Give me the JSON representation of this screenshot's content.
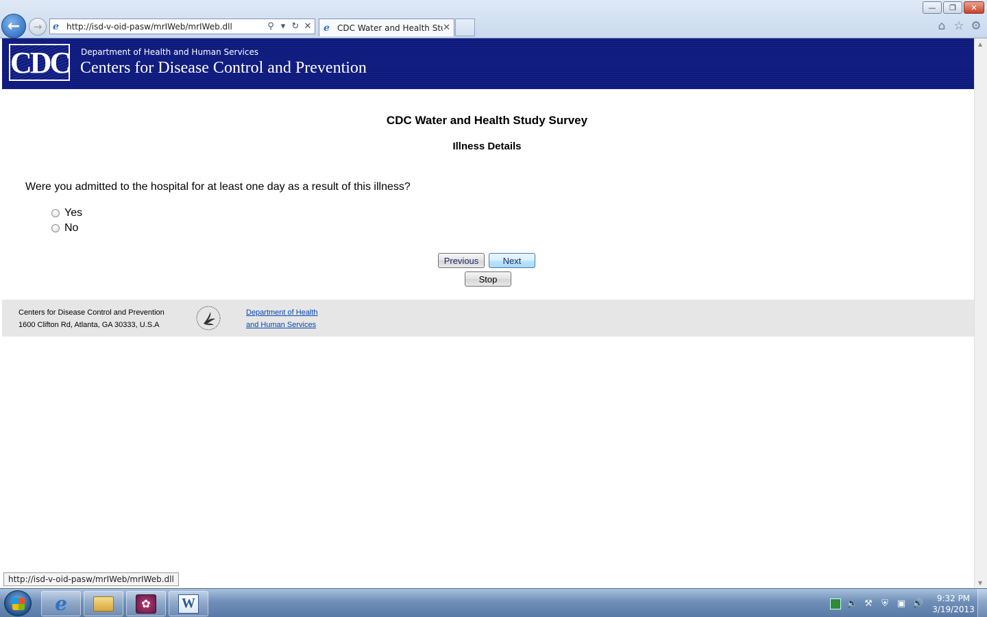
{
  "browser": {
    "address_url": "http://isd-v-oid-pasw/mrIWeb/mrIWeb.dll",
    "tab_title": "CDC Water and Health Study",
    "window_buttons": [
      "minimize",
      "restore",
      "close"
    ],
    "toolbar_icons": [
      "home-icon",
      "star-icon",
      "gear-icon"
    ]
  },
  "header": {
    "logo_text": "CDC",
    "department": "Department of Health and Human Services",
    "agency": "Centers for Disease Control and Prevention"
  },
  "survey": {
    "title": "CDC Water and Health Study Survey",
    "section": "Illness Details",
    "question": "Were you admitted to the hospital for at least one day as a result of this illness?",
    "options": [
      {
        "label": "Yes",
        "selected": false
      },
      {
        "label": "No",
        "selected": false
      }
    ],
    "buttons": {
      "previous": "Previous",
      "next": "Next",
      "stop": "Stop"
    }
  },
  "footer": {
    "org": "Centers for Disease Control and Prevention",
    "address": "1600 Clifton Rd, Atlanta, GA 30333, U.S.A",
    "link_line1": "Department of Health",
    "link_line2": "and Human Services"
  },
  "status_bar": {
    "url": "http://isd-v-oid-pasw/mrIWeb/mrIWeb.dll"
  },
  "taskbar": {
    "items": [
      "internet-explorer",
      "windows-explorer",
      "app",
      "microsoft-word"
    ],
    "clock_time": "9:32 PM",
    "clock_date": "3/19/2013"
  },
  "colors": {
    "header_bg": "#0e1a7d",
    "footer_bg": "#e6e6e6",
    "link": "#0645ad"
  }
}
